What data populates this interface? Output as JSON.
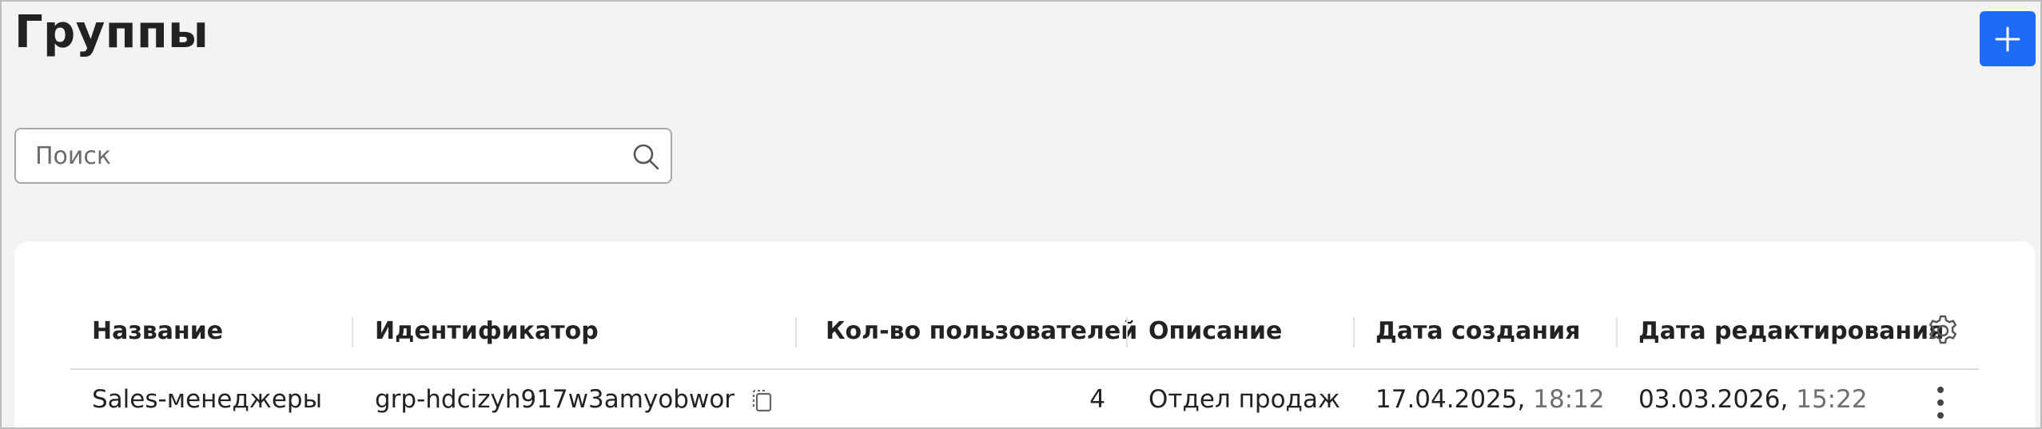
{
  "page": {
    "title": "Группы"
  },
  "toolbar": {
    "add_icon": "plus-icon",
    "accent_color": "#1e6af5"
  },
  "search": {
    "placeholder": "Поиск",
    "value": "",
    "icon": "search-icon"
  },
  "table": {
    "columns": [
      "Название",
      "Идентификатор",
      "Кол-во пользователей",
      "Описание",
      "Дата создания",
      "Дата редактирования"
    ],
    "settings_icon": "gear-icon",
    "rows": [
      {
        "name": "Sales-менеджеры",
        "id": "grp-hdcizyh917w3amyobwor",
        "users": "4",
        "description": "Отдел продаж",
        "created_date": "17.04.2025,",
        "created_time": "18:12",
        "edited_date": "03.03.2026,",
        "edited_time": "15:22"
      }
    ]
  }
}
